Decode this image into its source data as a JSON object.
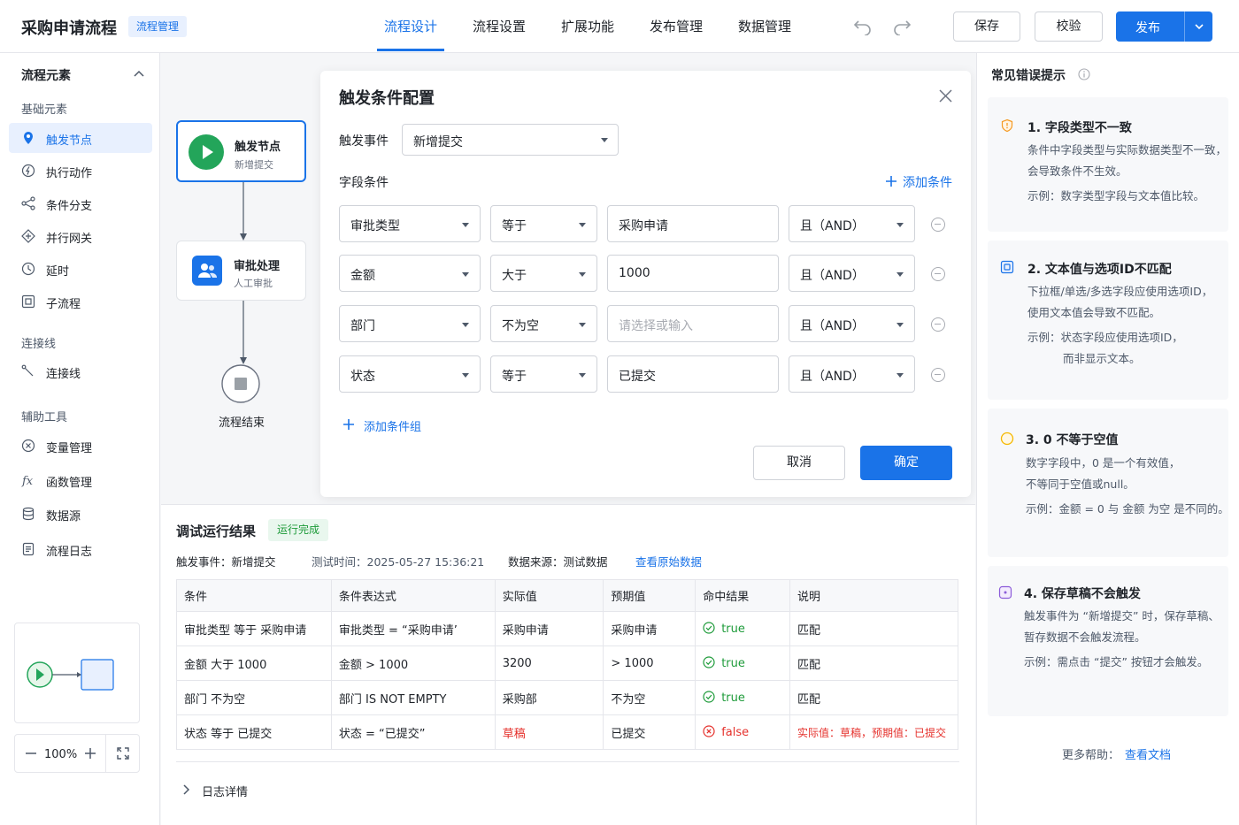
{
  "header": {
    "title": "采购申请流程",
    "tag": "流程管理",
    "tabs": [
      "流程设计",
      "流程设置",
      "扩展功能",
      "发布管理",
      "数据管理"
    ],
    "active_tab": "流程设计",
    "save_label": "保存",
    "validate_label": "校验",
    "publish_label": "发布"
  },
  "sidebar": {
    "title": "流程元素",
    "groups": {
      "basic": "基础元素",
      "connector": "连接线",
      "tools": "辅助工具"
    },
    "basic_items": [
      "触发节点",
      "执行动作",
      "条件分支",
      "并行网关",
      "延时",
      "子流程"
    ],
    "connector_items": [
      "连接线"
    ],
    "tool_items": [
      "变量管理",
      "函数管理",
      "数据源",
      "流程日志"
    ],
    "zoom": "100%"
  },
  "canvas": {
    "trigger_node": {
      "title": "触发节点",
      "subtitle": "新增提交"
    },
    "approval_node": {
      "title": "审批处理",
      "subtitle": "人工审批"
    },
    "end_node": {
      "label": "流程结束"
    }
  },
  "dialog": {
    "title": "触发条件配置",
    "event_label": "触发事件",
    "event_value": "新增提交",
    "field_conditions_label": "字段条件",
    "add_condition": "添加条件",
    "conditions": [
      {
        "field": "审批类型",
        "operator": "等于",
        "value": "采购申请",
        "logic": "且（AND）"
      },
      {
        "field": "金额",
        "operator": "大于",
        "value": "1000",
        "logic": "且（AND）"
      },
      {
        "field": "部门",
        "operator": "不为空",
        "value": "",
        "placeholder": "请选择或输入",
        "logic": "且（AND）"
      },
      {
        "field": "状态",
        "operator": "等于",
        "value": "已提交",
        "logic": "且（AND）"
      }
    ],
    "add_group": "添加条件组",
    "cancel": "取消",
    "confirm": "确定"
  },
  "debug": {
    "title": "调试运行结果",
    "status": "运行完成",
    "meta": {
      "event": "触发事件：新增提交",
      "time": "测试时间：2025-05-27 15:36:21",
      "source": "数据来源：测试数据",
      "view_raw": "查看原始数据"
    },
    "columns": [
      "条件",
      "条件表达式",
      "实际值",
      "预期值",
      "命中结果",
      "说明"
    ],
    "rows": [
      {
        "cond": "审批类型 等于 采购申请",
        "expr": "审批类型 = “采购申请’",
        "actual": "采购申请",
        "expected": "采购申请",
        "hit": "true",
        "note": "匹配"
      },
      {
        "cond": "金额 大于 1000",
        "expr": "金额 > 1000",
        "actual": "3200",
        "expected": "> 1000",
        "hit": "true",
        "note": "匹配"
      },
      {
        "cond": "部门 不为空",
        "expr": "部门 IS NOT EMPTY",
        "actual": "采购部",
        "expected": "不为空",
        "hit": "true",
        "note": "匹配"
      },
      {
        "cond": "状态 等于 已提交",
        "expr": "状态 = “已提交”",
        "actual": "草稿",
        "expected": "已提交",
        "hit": "false",
        "note": "实际值：草稿，预期值：已提交"
      }
    ],
    "log_details": "日志详情"
  },
  "tips": {
    "title": "常见错误提示",
    "cards": [
      {
        "title": "1. 字段类型不一致",
        "desc": [
          "条件中字段类型与实际数据类型不一致，",
          "会导致条件不生效。"
        ],
        "example": [
          "示例：数字类型字段与文本值比较。"
        ]
      },
      {
        "title": "2. 文本值与选项ID不匹配",
        "desc": [
          "下拉框/单选/多选字段应使用选项ID，",
          "使用文本值会导致不匹配。"
        ],
        "example": [
          "示例：状态字段应使用选项ID，",
          "而非显示文本。"
        ]
      },
      {
        "title": "3. 0 不等于空值",
        "desc": [
          "数字字段中，0 是一个有效值，",
          "不等同于空值或null。"
        ],
        "example": [
          "示例：金额 = 0 与 金额 为空 是不同的。"
        ]
      },
      {
        "title": "4. 保存草稿不会触发",
        "desc": [
          "触发事件为 “新增提交” 时，保存草稿、",
          "暂存数据不会触发流程。"
        ],
        "example": [
          "示例：需点击 “提交” 按钮才会触发。"
        ]
      }
    ],
    "help_label": "更多帮助：",
    "help_link": "查看文档"
  },
  "colors": {
    "accent": "#1a73e8",
    "success": "#1e9b3a",
    "error": "#e5312c",
    "trigger_green": "#23a55a"
  }
}
